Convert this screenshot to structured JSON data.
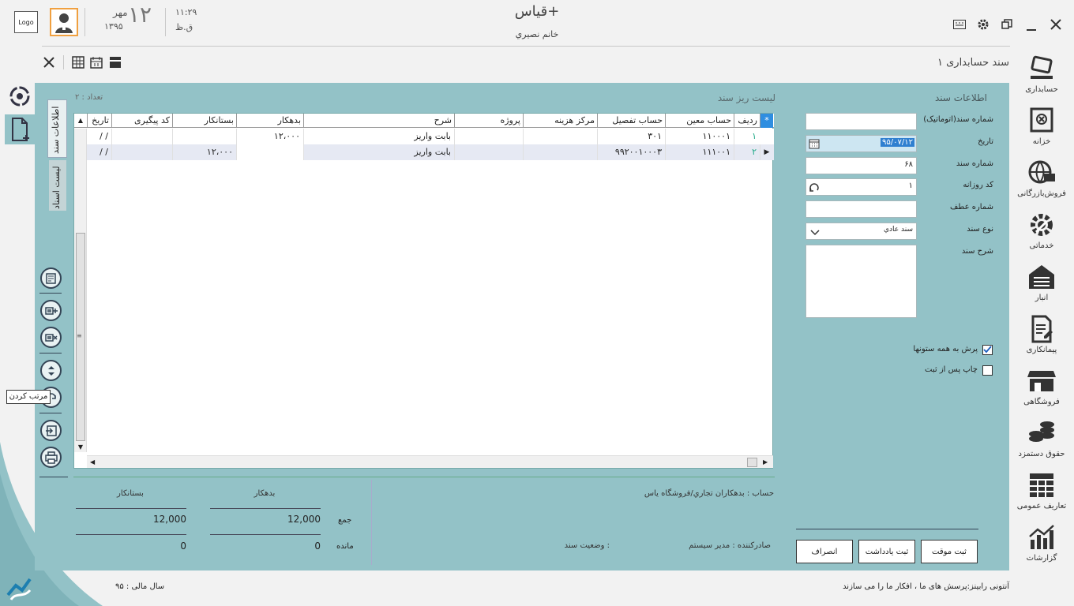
{
  "app": {
    "title": "قیاس+",
    "user": "خانم نصيري",
    "logo": "Logo",
    "date_day": "۱۲",
    "date_month": "مهر",
    "date_year": "۱۳۹۵",
    "time": "۱۱:۲۹",
    "ampm": "ق.ظ"
  },
  "window_title": "سند حسابداری ۱",
  "panel": {
    "info_title": "اطلاعات سند",
    "list_title": "لیست ریز سند",
    "count": "تعداد : ۲",
    "tabs": [
      "اطلاعات سند",
      "لیست اسناد"
    ]
  },
  "form": {
    "doc_number_auto_label": "شماره سند(اتوماتیک)",
    "date_label": "تاریخ",
    "date_value": "۹۵/۰۷/۱۲",
    "doc_number_label": "شماره سند",
    "doc_number_value": "۶۸",
    "daily_code_label": "کد روزانه",
    "daily_code_value": "۱",
    "ref_number_label": "شماره عطف",
    "doc_type_label": "نوع سند",
    "doc_type_value": "سند عادي",
    "doc_desc_label": "شرح سند",
    "jump_all_label": "پرش به همه ستونها",
    "print_after_label": "چاپ پس از ثبت"
  },
  "grid": {
    "columns": [
      "ردیف",
      "حساب معین",
      "حساب تفصیل",
      "مرکز هزینه",
      "پروژه",
      "شرح",
      "بدهکار",
      "بستانکار",
      "کد پیگیری",
      "تاریخ"
    ],
    "rows": [
      {
        "row": "۱",
        "moein": "۱۱۰۰۰۱",
        "tafsil": "۳۰۱",
        "center": "",
        "project": "",
        "desc": "بابت واریز",
        "debit": "۱۲،۰۰۰",
        "credit": "",
        "track": "",
        "date": "/  /"
      },
      {
        "row": "۲",
        "moein": "۱۱۱۰۰۱",
        "tafsil": "۹۹۲۰۰۱۰۰۰۳",
        "center": "",
        "project": "",
        "desc": "بابت واریز",
        "debit": "",
        "credit": "۱۲،۰۰۰",
        "track": "",
        "date": "/  /"
      }
    ]
  },
  "summary": {
    "account_label": "حساب : بدهکاران تجاري/فروشگاه یاس",
    "debit_label": "بدهکار",
    "credit_label": "بستانکار",
    "sum_label": "جمع",
    "sum_debit": "12,000",
    "sum_credit": "12,000",
    "rem_label": "مانده",
    "rem_debit": "0",
    "rem_credit": "0",
    "issuer": "صادرکننده : مدیر سیستم",
    "status": "وضعیت سند :"
  },
  "buttons": {
    "temp_save": "ثبت موقت",
    "note_save": "ثبت یادداشت",
    "cancel": "انصراف"
  },
  "tooltip": "مرتب کردن",
  "nav": [
    {
      "label": "حسابداری",
      "icon": "accounting-icon"
    },
    {
      "label": "خزانه",
      "icon": "treasury-icon"
    },
    {
      "label": "فروش‌بازرگانی",
      "icon": "sales-icon"
    },
    {
      "label": "خدماتی",
      "icon": "services-icon"
    },
    {
      "label": "انبار",
      "icon": "warehouse-icon"
    },
    {
      "label": "پیمانکاری",
      "icon": "contracting-icon"
    },
    {
      "label": "فروشگاهی",
      "icon": "store-icon"
    },
    {
      "label": "حقوق دستمزد",
      "icon": "payroll-icon"
    },
    {
      "label": "تعاریف عمومی",
      "icon": "definitions-icon"
    },
    {
      "label": "گزارشات",
      "icon": "reports-icon"
    }
  ],
  "footer": {
    "fiscal_year": "سال مالی : ۹۵",
    "slogan": "آنتونی رابینز:پرسش های ما ، افکار ما را می سازند"
  }
}
